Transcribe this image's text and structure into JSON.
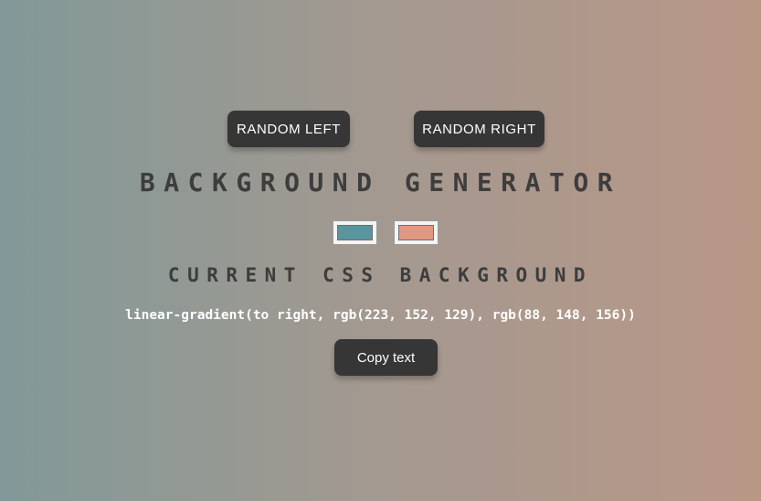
{
  "buttons": {
    "random_left": "RANDOM LEFT",
    "random_right": "RANDOM RIGHT",
    "copy": "Copy text"
  },
  "title": "BACKGROUND GENERATOR",
  "subtitle": "CURRENT CSS BACKGROUND",
  "css_output": "linear-gradient(to right, rgb(223, 152, 129), rgb(88, 148, 156))",
  "colors": {
    "left_picker": "#5a949c",
    "right_picker": "#df9881",
    "button_bg": "#363636",
    "heading_text": "#3d3d3d"
  }
}
